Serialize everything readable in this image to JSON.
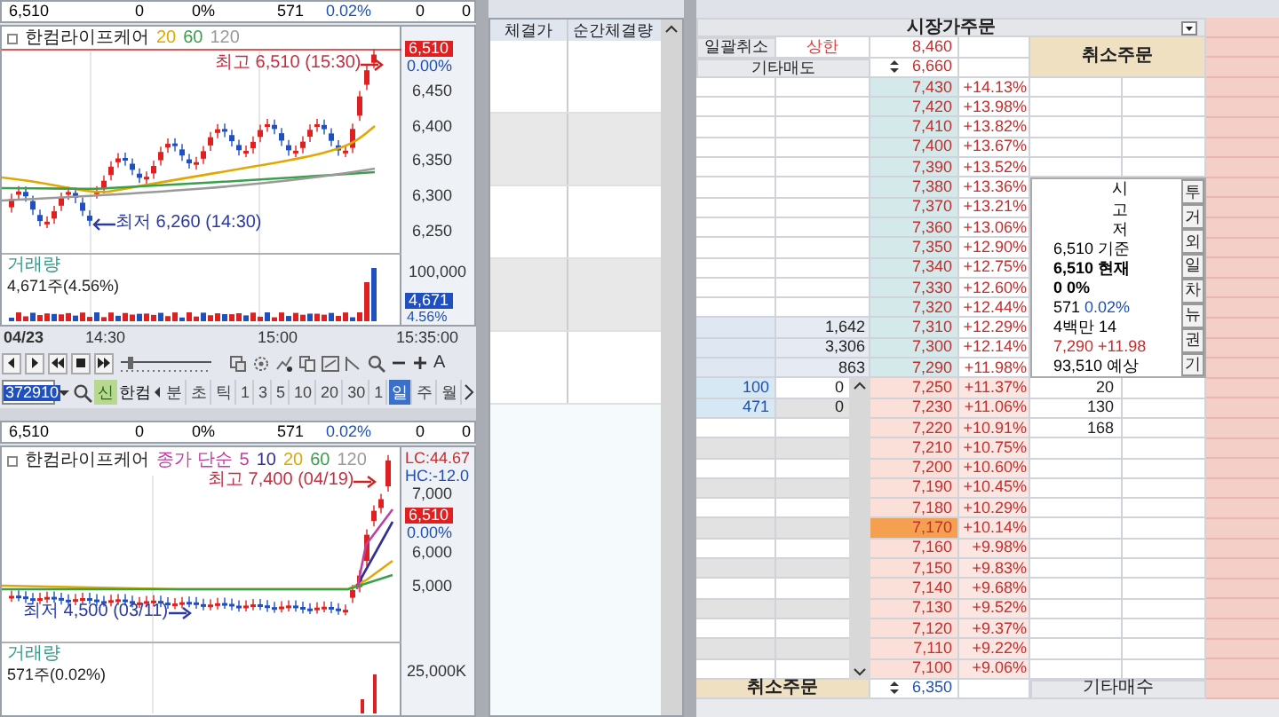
{
  "top_chart": {
    "info": [
      "6,510",
      "0",
      "0%",
      "571",
      "0.02%",
      "0",
      "0"
    ],
    "title": "한컴라이프케어",
    "ma_labels": [
      {
        "label": "20",
        "color": "#e0a800"
      },
      {
        "label": "60",
        "color": "#3aa04a"
      },
      {
        "label": "120",
        "color": "#9a9a9a"
      }
    ],
    "high_label": "최고 6,510 (15:30)",
    "low_label": "최저 6,260 (14:30)",
    "price_axis": [
      "6,450",
      "6,400",
      "6,350",
      "6,300",
      "6,250"
    ],
    "current_price": "6,510",
    "current_change": "0.00%",
    "volume_title": "거래량",
    "volume_text": "4,671주(4.56%)",
    "volume_axis": "100,000",
    "volume_current": "4,671",
    "volume_pct": "4.56%",
    "time_axis": [
      "04/23",
      "14:30",
      "15:00",
      "15:35:00"
    ],
    "font_button": "A",
    "code": "372910",
    "market_badge": "신",
    "name": "한컴",
    "units": [
      {
        "label": "분",
        "selected": false
      },
      {
        "label": "초",
        "selected": false
      },
      {
        "label": "틱",
        "selected": false
      },
      {
        "label": "1",
        "selected": false
      },
      {
        "label": "3",
        "selected": false
      },
      {
        "label": "5",
        "selected": false
      },
      {
        "label": "10",
        "selected": false
      },
      {
        "label": "20",
        "selected": false
      },
      {
        "label": "30",
        "selected": false
      },
      {
        "label": "1",
        "selected": false
      },
      {
        "label": "일",
        "selected": true
      },
      {
        "label": "주",
        "selected": false
      },
      {
        "label": "월",
        "selected": false
      }
    ]
  },
  "bottom_chart": {
    "info": [
      "6,510",
      "0",
      "0%",
      "571",
      "0.02%",
      "0",
      "0"
    ],
    "title": "한컴라이프케어",
    "ma_type": "종가 단순",
    "ma_labels": [
      {
        "label": "5",
        "color": "#c040a0"
      },
      {
        "label": "10",
        "color": "#303090"
      },
      {
        "label": "20",
        "color": "#e0a800"
      },
      {
        "label": "60",
        "color": "#3aa04a"
      },
      {
        "label": "120",
        "color": "#9a9a9a"
      }
    ],
    "lc": "LC:44.67",
    "hc": "HC:-12.0",
    "high_label": "최고 7,400 (04/19)",
    "low_label": "최저 4,500 (03/11)",
    "price_axis": [
      "7,000",
      "6,000",
      "5,000"
    ],
    "current_price": "6,510",
    "current_change": "0.00%",
    "volume_title": "거래량",
    "volume_text": "571주(0.02%)",
    "volume_axis": "25,000K"
  },
  "trades": {
    "columns": [
      "체결가",
      "순간체결량"
    ]
  },
  "order_book": {
    "title": "시장가주문",
    "cancel_all": "일괄취소",
    "upper_label": "상한",
    "upper_price": "8,460",
    "other_sell": "기타매도",
    "other_sell_price": "6,660",
    "cancel_order_top": "취소주문",
    "asks": [
      {
        "price": "7,430",
        "change": "+14.13%"
      },
      {
        "price": "7,420",
        "change": "+13.98%"
      },
      {
        "price": "7,410",
        "change": "+13.82%"
      },
      {
        "price": "7,400",
        "change": "+13.67%"
      },
      {
        "price": "7,390",
        "change": "+13.52%"
      },
      {
        "price": "7,380",
        "change": "+13.36%"
      },
      {
        "price": "7,370",
        "change": "+13.21%"
      },
      {
        "price": "7,360",
        "change": "+13.06%"
      },
      {
        "price": "7,350",
        "change": "+12.90%"
      },
      {
        "price": "7,340",
        "change": "+12.75%"
      },
      {
        "price": "7,330",
        "change": "+12.60%"
      },
      {
        "price": "7,320",
        "change": "+12.44%"
      },
      {
        "price": "7,310",
        "change": "+12.29%",
        "qty": "1,642"
      },
      {
        "price": "7,300",
        "change": "+12.14%",
        "qty": "3,306"
      },
      {
        "price": "7,290",
        "change": "+11.98%",
        "qty": "863"
      }
    ],
    "price_headers": [
      "시",
      "고",
      "저"
    ],
    "info_lines": [
      {
        "text": "6,510 기준",
        "kind": "plain"
      },
      {
        "text": "6,510 현재",
        "kind": "bold"
      },
      {
        "text": "0 0%",
        "kind": "bold"
      },
      {
        "text": "571 0.02%",
        "kind": "fall"
      },
      {
        "text": "4백만 14",
        "kind": "plain"
      },
      {
        "text": "7,290 +11.98",
        "kind": "rise"
      },
      {
        "text": "93,510 예상",
        "kind": "plain"
      }
    ],
    "side_buttons": [
      "투",
      "거",
      "외",
      "일",
      "차",
      "뉴",
      "권",
      "기"
    ],
    "bids": [
      {
        "price": "7,250",
        "change": "+11.37%",
        "my_qty": "100",
        "my_qty2": "0",
        "qty": "20",
        "selected": false
      },
      {
        "price": "7,230",
        "change": "+11.06%",
        "my_qty": "471",
        "my_qty2": "0",
        "qty": "130",
        "selected": false
      },
      {
        "price": "7,220",
        "change": "+10.91%",
        "qty": "168",
        "selected": false
      },
      {
        "price": "7,210",
        "change": "+10.75%",
        "selected": false
      },
      {
        "price": "7,200",
        "change": "+10.60%",
        "selected": false
      },
      {
        "price": "7,190",
        "change": "+10.45%",
        "selected": false
      },
      {
        "price": "7,180",
        "change": "+10.29%",
        "selected": false
      },
      {
        "price": "7,170",
        "change": "+10.14%",
        "selected": true
      },
      {
        "price": "7,160",
        "change": "+9.98%",
        "selected": false
      },
      {
        "price": "7,150",
        "change": "+9.83%",
        "selected": false
      },
      {
        "price": "7,140",
        "change": "+9.68%",
        "selected": false
      },
      {
        "price": "7,130",
        "change": "+9.52%",
        "selected": false
      },
      {
        "price": "7,120",
        "change": "+9.37%",
        "selected": false
      },
      {
        "price": "7,110",
        "change": "+9.22%",
        "selected": false
      },
      {
        "price": "7,100",
        "change": "+9.06%",
        "selected": false
      }
    ],
    "cancel_order_bottom": "취소주문",
    "lower_price": "6,350",
    "other_buy": "기타매수"
  }
}
